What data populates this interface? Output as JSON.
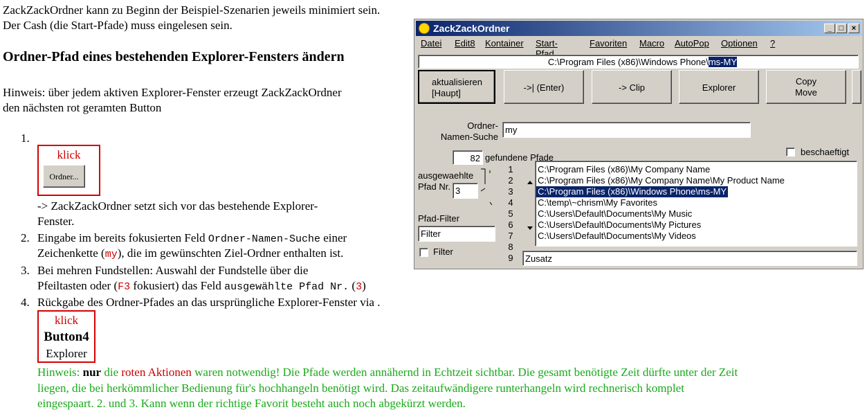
{
  "doc": {
    "line1": "ZackZackOrdner kann zu Beginn der Beispiel-Szenarien jeweils minimiert sein.",
    "line2": "Der Cash (die Start-Pfade) muss eingelesen sein.",
    "heading": "Ordner-Pfad eines bestehenden Explorer-Fensters ändern",
    "hint1a": "Hinweis: über jedem aktiven Explorer-Fenster erzeugt ZackZackOrdner",
    "hint1b": "den nächsten rot geramten Button",
    "n1": "1.",
    "klick1": "klick",
    "ordner_btn": "Ordner...",
    "step1a": "-> ZackZackOrdner setzt sich vor das bestehende Explorer-",
    "step1b": "Fenster.",
    "n2": "2.",
    "step2a_pre": "Eingabe im bereits fokusierten Feld ",
    "step2a_code": "Ordner-Namen-Suche",
    "step2a_post": " einer",
    "step2b_pre": "Zeichenkette (",
    "step2b_code": "my",
    "step2b_post": "), die im gewünschten Ziel-Ordner enthalten ist.",
    "n3": "3.",
    "step3a": "Bei mehren Fundstellen: Auswahl der Fundstelle über die",
    "step3b_pre": "Pfeiltasten oder (",
    "step3b_code1": "F3",
    "step3b_mid": " fokusiert) das Feld ",
    "step3b_code2": "ausgewählte Pfad Nr.",
    "step3b_mid2": " (",
    "step3b_code3": "3",
    "step3b_post": ")",
    "n4": "4.",
    "step4": "Rückgabe des Ordner-Pfades an das ursprüngliche Explorer-Fenster via .",
    "klick2": "klick",
    "button4": "Button4",
    "explorer": "Explorer",
    "final1_pre": "Hinweis: ",
    "final1_bold": "nur",
    "final1_mid": " die ",
    "final1_red": "roten Aktionen",
    "final1_post": " waren notwendig! Die Pfade werden annähernd in Echtzeit sichtbar. Die gesamt benötigte Zeit dürfte unter der Zeit",
    "final2": "liegen, die bei herkömmlicher Bedienung für's hochhangeln benötigt wird. Das zeitaufwändigere runterhangeln wird rechnerisch komplet",
    "final3": "eingespaart. 2. und 3. Kann wenn der richtige Favorit besteht auch noch abgekürzt werden."
  },
  "app": {
    "title": "ZackZackOrdner",
    "menu": [
      "Datei",
      "Edit8",
      "Kontainer",
      "Start-Pfad",
      "Favoriten",
      "Macro",
      "AutoPop",
      "Optionen",
      "?"
    ],
    "path_prefix": "C:\\Program Files (x86)\\Windows Phone\\",
    "path_selected": "ms-MY",
    "buttons": {
      "refresh_line1": "aktualisieren",
      "refresh_line2": "[Haupt]",
      "enter": "->|  (Enter)",
      "clip": "-> Clip",
      "explorer": "Explorer",
      "copy_line1": "Copy",
      "copy_line2": "Move"
    },
    "search_label1": "Ordner-",
    "search_label2": "Namen-Suche",
    "search_value": "my",
    "found_count": "82",
    "found_label": "gefundene  Pfade",
    "busy_label": "beschaeftigt",
    "selected_label1": "ausgewaehlte",
    "selected_label2": "Pfad Nr.",
    "selected_value": "3",
    "filter_label": "Pfad-Filter",
    "filter_value": "Filter",
    "filter_check_label": "Filter",
    "row_numbers": [
      "1",
      "2",
      "3",
      "4",
      "5",
      "6",
      "7",
      "8",
      "9"
    ],
    "paths": [
      "C:\\Program Files (x86)\\My Company Name",
      "C:\\Program Files (x86)\\My Company Name\\My Product Name",
      "C:\\Program Files (x86)\\Windows Phone\\ms-MY",
      "C:\\temp\\~chrism\\My Favorites",
      "C:\\Users\\Default\\Documents\\My Music",
      "C:\\Users\\Default\\Documents\\My Pictures",
      "C:\\Users\\Default\\Documents\\My Videos"
    ],
    "selected_index": 2,
    "extra_value": "Zusatz"
  }
}
